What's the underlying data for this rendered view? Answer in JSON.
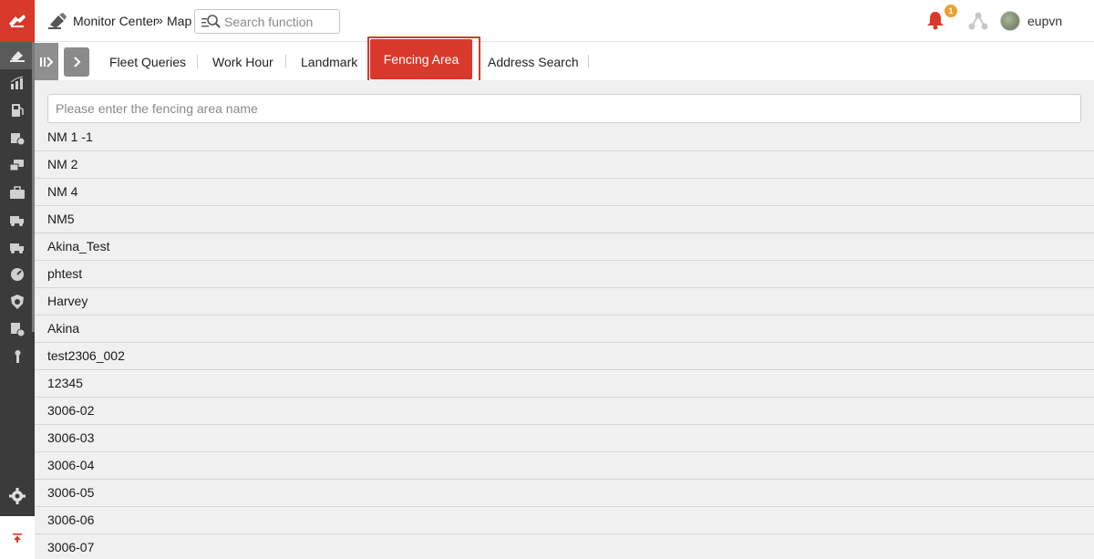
{
  "header": {
    "breadcrumb_parent": "Monitor Center",
    "breadcrumb_separator": "»",
    "breadcrumb_current": "Map",
    "search_placeholder": "Search function",
    "notification_count": "1",
    "username": "eupvn"
  },
  "tabs": [
    {
      "label": "Fleet Queries"
    },
    {
      "label": "Work Hour"
    },
    {
      "label": "Landmark"
    },
    {
      "label": "Fencing Area",
      "active": true
    },
    {
      "label": "Address Search"
    }
  ],
  "fencing": {
    "search_placeholder": "Please enter the fencing area name",
    "items": [
      "NM 1 -1",
      "NM 2",
      "NM 4",
      "NM5",
      "Akina_Test",
      "phtest",
      "Harvey",
      "Akina",
      "test2306_002",
      "12345",
      "3006-02",
      "3006-03",
      "3006-04",
      "3006-05",
      "3006-06",
      "3006-07"
    ]
  },
  "sidebar": {
    "icons": [
      "logo-icon",
      "monitor-icon",
      "report-icon",
      "fuel-icon",
      "cargo-icon",
      "dispatch-icon",
      "work-icon",
      "vehicle-icon",
      "vehicle-alert-icon",
      "speed-icon",
      "safety-icon",
      "maintenance-icon",
      "tools-icon",
      "settings-icon",
      "back-to-top-icon"
    ]
  },
  "colors": {
    "accent": "#d9392b",
    "sidebar_bg": "#3b3b3b",
    "badge": "#f0a030"
  }
}
